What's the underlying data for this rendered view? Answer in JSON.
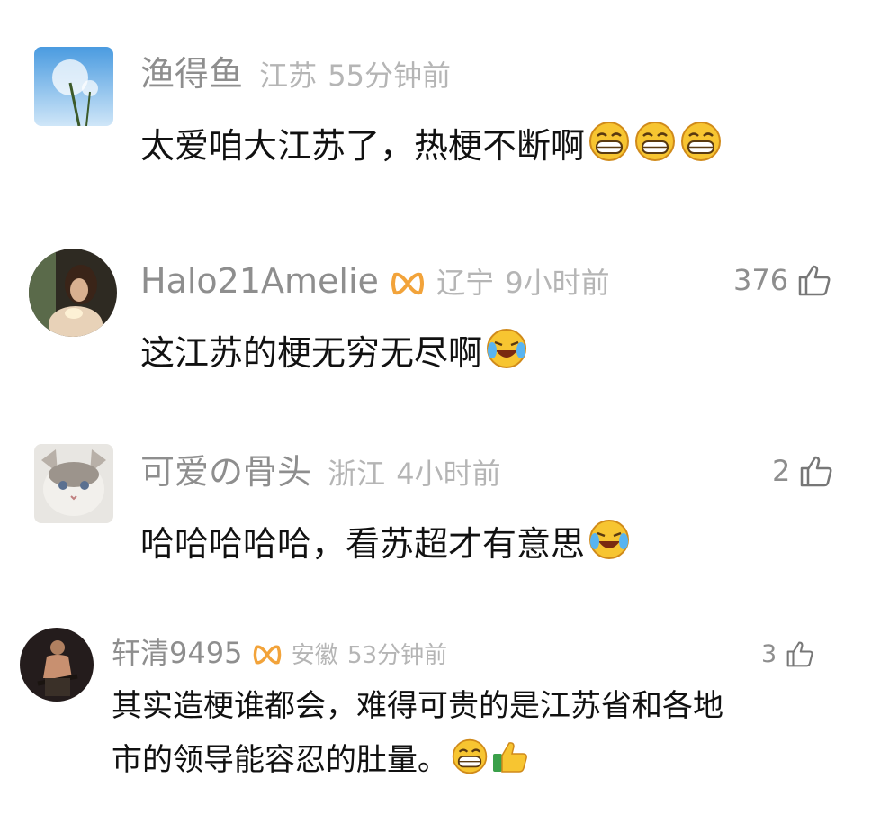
{
  "comments": [
    {
      "user": "渔得鱼",
      "location": "江苏",
      "time": "55分钟前",
      "likes": "",
      "text": "太爱咱大江苏了，热梗不断啊",
      "emojis": [
        "grin-emoji",
        "grin-emoji",
        "grin-emoji"
      ],
      "vip": false
    },
    {
      "user": "Halo21Amelie",
      "location": "辽宁",
      "time": "9小时前",
      "likes": "376",
      "text": "这江苏的梗无穷无尽啊",
      "emojis": [
        "laugh-cry-emoji"
      ],
      "vip": true
    },
    {
      "user": "可爱の骨头",
      "location": "浙江",
      "time": "4小时前",
      "likes": "2",
      "text": "哈哈哈哈哈，看苏超才有意思",
      "emojis": [
        "laugh-cry-emoji"
      ],
      "vip": false
    },
    {
      "user": "轩清9495",
      "location": "安徽",
      "time": "53分钟前",
      "likes": "3",
      "text_line1": "其实造梗谁都会，难得可贵的是江苏省和各地",
      "text_line2": "市的领导能容忍的肚量。",
      "emojis": [
        "grin-emoji",
        "thumbs-up-emoji"
      ],
      "vip": true
    }
  ],
  "colors": {
    "username": "#8e8e8e",
    "meta": "#b5b5b5",
    "vip_badge": "#f2a33a",
    "emoji_yellow": "#f7c531"
  }
}
